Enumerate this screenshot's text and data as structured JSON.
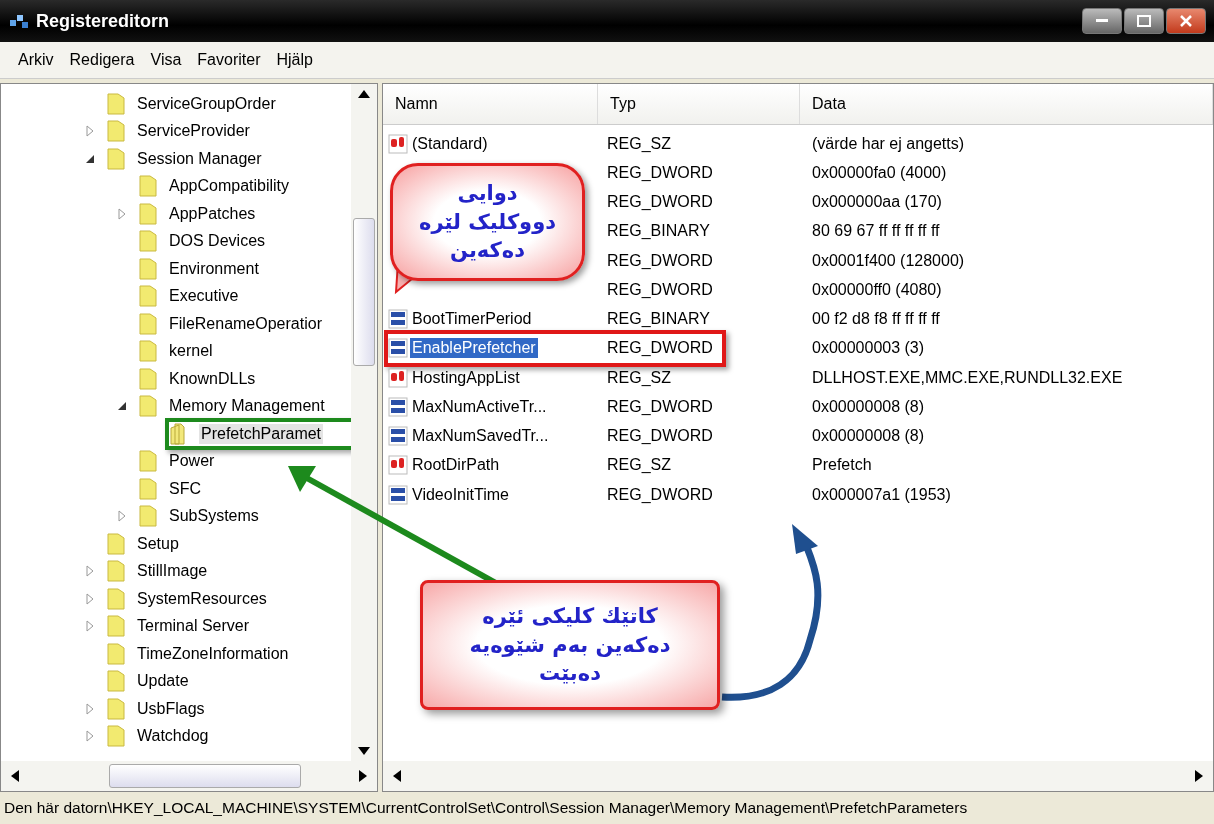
{
  "window": {
    "title": "Registereditorn"
  },
  "menu": [
    "Arkiv",
    "Redigera",
    "Visa",
    "Favoriter",
    "Hjälp"
  ],
  "tree": [
    {
      "label": "ServiceGroupOrder",
      "selected": false,
      "marked": false
    },
    {
      "label": "ServiceProvider",
      "expanded": false,
      "selected": false,
      "marked": false
    },
    {
      "label": "Session Manager",
      "expanded": true,
      "selected": false,
      "marked": false,
      "children": [
        {
          "label": "AppCompatibility",
          "selected": false,
          "marked": false
        },
        {
          "label": "AppPatches",
          "expanded": false,
          "selected": false,
          "marked": false
        },
        {
          "label": "DOS Devices",
          "selected": false,
          "marked": false
        },
        {
          "label": "Environment",
          "selected": false,
          "marked": false
        },
        {
          "label": "Executive",
          "selected": false,
          "marked": false
        },
        {
          "label": "FileRenameOperatior",
          "selected": false,
          "marked": false
        },
        {
          "label": "kernel",
          "selected": false,
          "marked": false
        },
        {
          "label": "KnownDLLs",
          "selected": false,
          "marked": false
        },
        {
          "label": "Memory Management",
          "expanded": true,
          "selected": false,
          "marked": false,
          "children": [
            {
              "label": "PrefetchParamet",
              "selected": true,
              "marked": true
            }
          ]
        },
        {
          "label": "Power",
          "selected": false,
          "marked": false
        },
        {
          "label": "SFC",
          "selected": false,
          "marked": false
        },
        {
          "label": "SubSystems",
          "expanded": false,
          "selected": false,
          "marked": false
        }
      ]
    },
    {
      "label": "Setup",
      "selected": false,
      "marked": false
    },
    {
      "label": "StillImage",
      "expanded": false,
      "selected": false,
      "marked": false
    },
    {
      "label": "SystemResources",
      "expanded": false,
      "selected": false,
      "marked": false
    },
    {
      "label": "Terminal Server",
      "expanded": false,
      "selected": false,
      "marked": false
    },
    {
      "label": "TimeZoneInformation",
      "selected": false,
      "marked": false
    },
    {
      "label": "Update",
      "selected": false,
      "marked": false
    },
    {
      "label": "UsbFlags",
      "expanded": false,
      "selected": false,
      "marked": false
    },
    {
      "label": "Watchdog",
      "expanded": false,
      "selected": false,
      "marked": false
    }
  ],
  "table": {
    "columns": [
      "Namn",
      "Typ",
      "Data"
    ],
    "rows": [
      {
        "kind": "string",
        "name": "(Standard)",
        "type": "REG_SZ",
        "data": "(värde har ej angetts)",
        "selected": false,
        "marked": false
      },
      {
        "type": "REG_DWORD",
        "data": "0x00000fa0 (4000)",
        "selected": false,
        "marked": false
      },
      {
        "type": "REG_DWORD",
        "data": "0x000000aa (170)",
        "selected": false,
        "marked": false
      },
      {
        "type": "REG_BINARY",
        "data": "80 69 67 ff ff ff ff ff",
        "selected": false,
        "marked": false
      },
      {
        "type": "REG_DWORD",
        "data": "0x0001f400 (128000)",
        "selected": false,
        "marked": false
      },
      {
        "type": "REG_DWORD",
        "data": "0x00000ff0 (4080)",
        "selected": false,
        "marked": false
      },
      {
        "kind": "binary",
        "name": "BootTimerPeriod",
        "type": "REG_BINARY",
        "data": "00 f2 d8 f8 ff ff ff ff",
        "selected": false,
        "marked": false
      },
      {
        "kind": "binary",
        "name": "EnablePrefetcher",
        "type": "REG_DWORD",
        "data": "0x00000003 (3)",
        "selected": true,
        "marked": true
      },
      {
        "kind": "string",
        "name": "HostingAppList",
        "type": "REG_SZ",
        "data": "DLLHOST.EXE,MMC.EXE,RUNDLL32.EXE",
        "selected": false,
        "marked": false
      },
      {
        "kind": "binary",
        "name": "MaxNumActiveTr...",
        "type": "REG_DWORD",
        "data": "0x00000008 (8)",
        "selected": false,
        "marked": false
      },
      {
        "kind": "binary",
        "name": "MaxNumSavedTr...",
        "type": "REG_DWORD",
        "data": "0x00000008 (8)",
        "selected": false,
        "marked": false
      },
      {
        "kind": "string",
        "name": "RootDirPath",
        "type": "REG_SZ",
        "data": "Prefetch",
        "selected": false,
        "marked": false
      },
      {
        "kind": "binary",
        "name": "VideoInitTime",
        "type": "REG_DWORD",
        "data": "0x000007a1 (1953)",
        "selected": false,
        "marked": false
      }
    ]
  },
  "status_bar": "Den här datorn\\HKEY_LOCAL_MACHINE\\SYSTEM\\CurrentControlSet\\Control\\Session Manager\\Memory Management\\PrefetchParameters",
  "callouts": [
    {
      "kind": "bubble",
      "lines": [
        "دوایی",
        "دووکلیک لێره",
        "دەکەین"
      ]
    },
    {
      "kind": "box",
      "lines": [
        "کاتێك کلیکی ئێره",
        "دەکەین بەم شێوەیە",
        "دەبێت"
      ]
    }
  ]
}
